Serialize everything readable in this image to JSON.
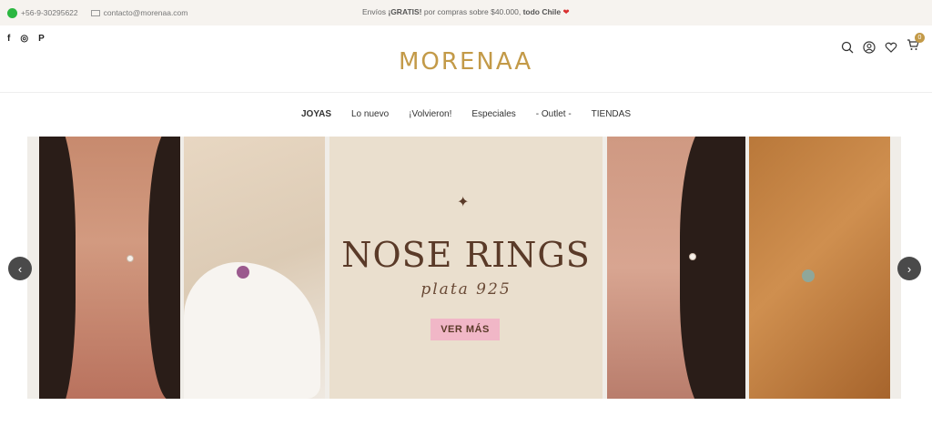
{
  "topbar": {
    "phone": "+56-9-30295622",
    "email": "contacto@morenaa.com",
    "promo_prefix": "Envíos ",
    "promo_bold": "¡GRATIS!",
    "promo_mid": " por compras sobre $40.000, ",
    "promo_bold2": "todo Chile",
    "promo_heart": "❤"
  },
  "header": {
    "logo": "MORENAA",
    "social": [
      "f",
      "◎",
      "P"
    ],
    "cart_count": "0"
  },
  "nav": {
    "items": [
      "JOYAS",
      "Lo nuevo",
      "¡Volvieron!",
      "Especiales",
      "- Outlet -",
      "TIENDAS"
    ]
  },
  "banner": {
    "title": "NOSE RINGS",
    "subtitle": "plata 925",
    "cta": "VER MÁS",
    "star": "✦"
  },
  "slider": {
    "prev": "‹",
    "next": "›"
  }
}
